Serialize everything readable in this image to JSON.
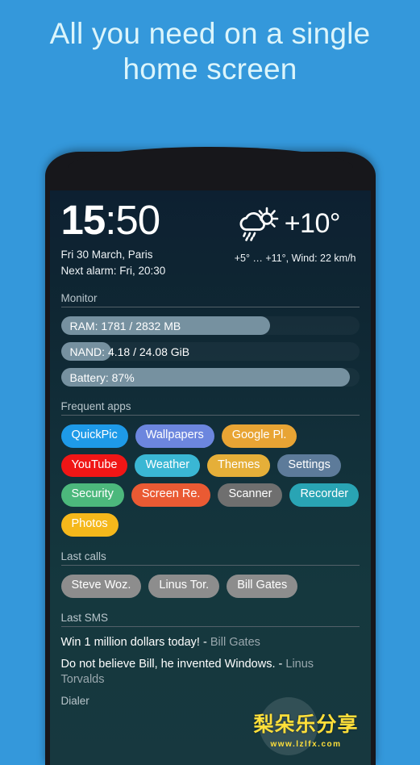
{
  "promo": {
    "headline_line1": "All you need on a single",
    "headline_line2": "home screen",
    "background_color": "#3498db",
    "headline_color": "#dcf5fb"
  },
  "device": {
    "frame_color": "#17171b",
    "screen_gradient_top": "#0d2031",
    "screen_gradient_bottom": "#17383f"
  },
  "clock": {
    "hours": "15",
    "separator": ":",
    "minutes": "50",
    "date_location": "Fri 30 March, Paris",
    "next_alarm": "Next alarm: Fri, 20:30"
  },
  "weather": {
    "icon": "sun-behind-rain-cloud-icon",
    "temperature": "+10°",
    "detail": "+5° … +11°, Wind: 22 km/h"
  },
  "monitor": {
    "title": "Monitor",
    "bars": [
      {
        "label": "RAM: 1781 / 2832 MB",
        "percent": 70,
        "fill_color": "#7691a0"
      },
      {
        "label": "NAND: 4.18 / 24.08 GiB",
        "percent": 17,
        "fill_color": "#7691a0"
      },
      {
        "label": "Battery: 87%",
        "percent": 97,
        "fill_color": "#7691a0"
      }
    ]
  },
  "frequent_apps": {
    "title": "Frequent apps",
    "chips": [
      {
        "label": "QuickPic",
        "color": "#1e9ae8"
      },
      {
        "label": "Wallpapers",
        "color": "#6c86de"
      },
      {
        "label": "Google Pl.",
        "color": "#e8a434"
      },
      {
        "label": "YouTube",
        "color": "#f01616"
      },
      {
        "label": "Weather",
        "color": "#3ab7d4"
      },
      {
        "label": "Themes",
        "color": "#e5af39"
      },
      {
        "label": "Settings",
        "color": "#5d7b9a"
      },
      {
        "label": "Security",
        "color": "#4cb87c"
      },
      {
        "label": "Screen Re.",
        "color": "#ea5a33"
      },
      {
        "label": "Scanner",
        "color": "#6f6f6f"
      },
      {
        "label": "Recorder",
        "color": "#29a4b4"
      },
      {
        "label": "Photos",
        "color": "#f5b81b"
      }
    ]
  },
  "last_calls": {
    "title": "Last calls",
    "chips": [
      {
        "label": "Steve Woz.",
        "color": "#8d8d8d"
      },
      {
        "label": "Linus Tor.",
        "color": "#8d8d8d"
      },
      {
        "label": "Bill Gates",
        "color": "#8d8d8d"
      }
    ]
  },
  "last_sms": {
    "title": "Last SMS",
    "messages": [
      {
        "text": "Win 1 million dollars today! - ",
        "sender": "Bill Gates"
      },
      {
        "text": "Do not believe Bill, he invented Windows. - ",
        "sender": "Linus Torvalds"
      }
    ]
  },
  "dialer": {
    "title": "Dialer"
  },
  "watermark": {
    "text": "梨朵乐分享",
    "url": "www.lzlfx.com",
    "color": "#ffdf3a"
  }
}
